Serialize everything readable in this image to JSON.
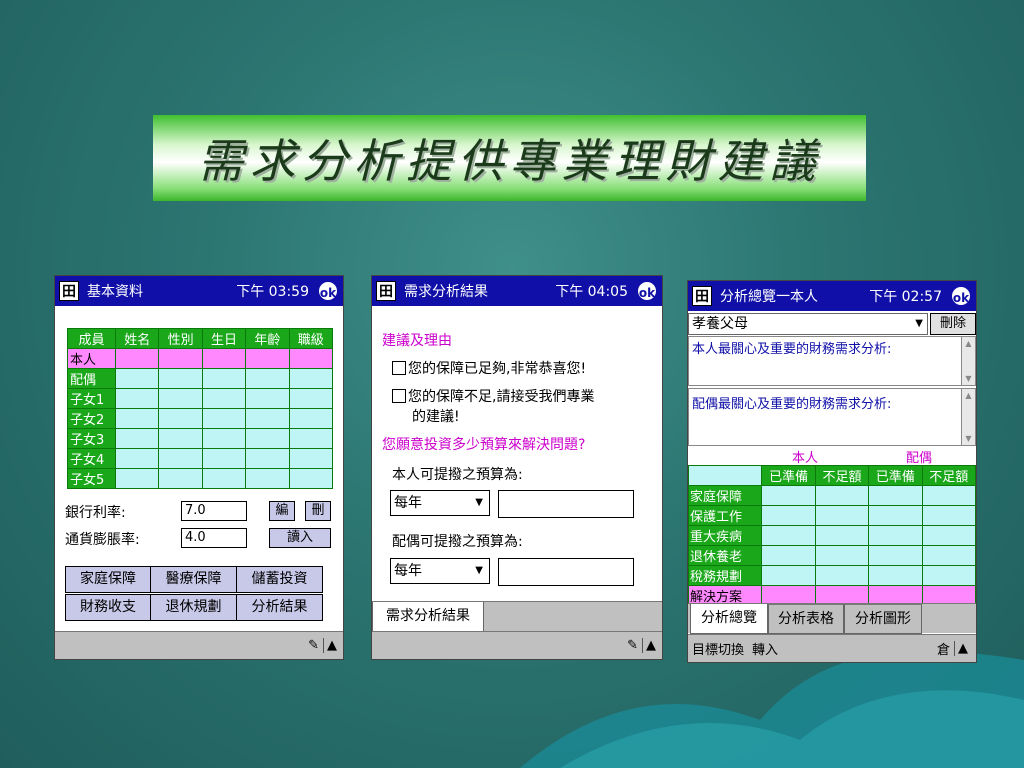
{
  "banner": {
    "title": "需求分析提供專業理財建議"
  },
  "phone1": {
    "title": "基本資料",
    "time": "下午 03:59",
    "ok": "ok",
    "table_headers": [
      "成員",
      "姓名",
      "性別",
      "生日",
      "年齡",
      "職級"
    ],
    "rows": [
      "本人",
      "配偶",
      "子女1",
      "子女2",
      "子女3",
      "子女4",
      "子女5"
    ],
    "bank_rate_label": "銀行利率:",
    "bank_rate_value": "7.0",
    "inflation_label": "通貨膨脹率:",
    "inflation_value": "4.0",
    "edit_button": "編",
    "delete_button": "刪",
    "load_button": "讀入",
    "categories": [
      "家庭保障",
      "醫療保障",
      "儲蓄投資",
      "財務收支",
      "退休規劃",
      "分析結果"
    ],
    "caret": "▲"
  },
  "phone2": {
    "title": "需求分析結果",
    "time": "下午 04:05",
    "ok": "ok",
    "advice_heading": "建議及理由",
    "option1": "您的保障已足夠,非常恭喜您!",
    "option2_line1": "您的保障不足,請接受我們專業",
    "option2_line2": "的建議!",
    "budget_question": "您願意投資多少預算來解決問題?",
    "self_budget_label": "本人可提撥之預算為:",
    "spouse_budget_label": "配偶可提撥之預算為:",
    "period_self": "每年",
    "period_spouse": "每年",
    "tab": "需求分析結果",
    "caret": "▲"
  },
  "phone3": {
    "title": "分析總覽一本人",
    "time": "下午 02:57",
    "ok": "ok",
    "select_value": "孝養父母",
    "delete_button": "刪除",
    "self_concern_label": "本人最關心及重要的財務需求分析:",
    "spouse_concern_label": "配偶最關心及重要的財務需求分析:",
    "col_self": "本人",
    "col_spouse": "配偶",
    "sub_headers": [
      "已準備",
      "不足額",
      "已準備",
      "不足額"
    ],
    "rows": [
      "家庭保障",
      "保護工作",
      "重大疾病",
      "退休養老",
      "稅務規劃",
      "解決方案"
    ],
    "tabs": [
      "分析總覽",
      "分析表格",
      "分析圖形"
    ],
    "menu_switch": "目標切換",
    "menu_import": "轉入",
    "kb_icon_label": "倉",
    "caret": "▲"
  }
}
